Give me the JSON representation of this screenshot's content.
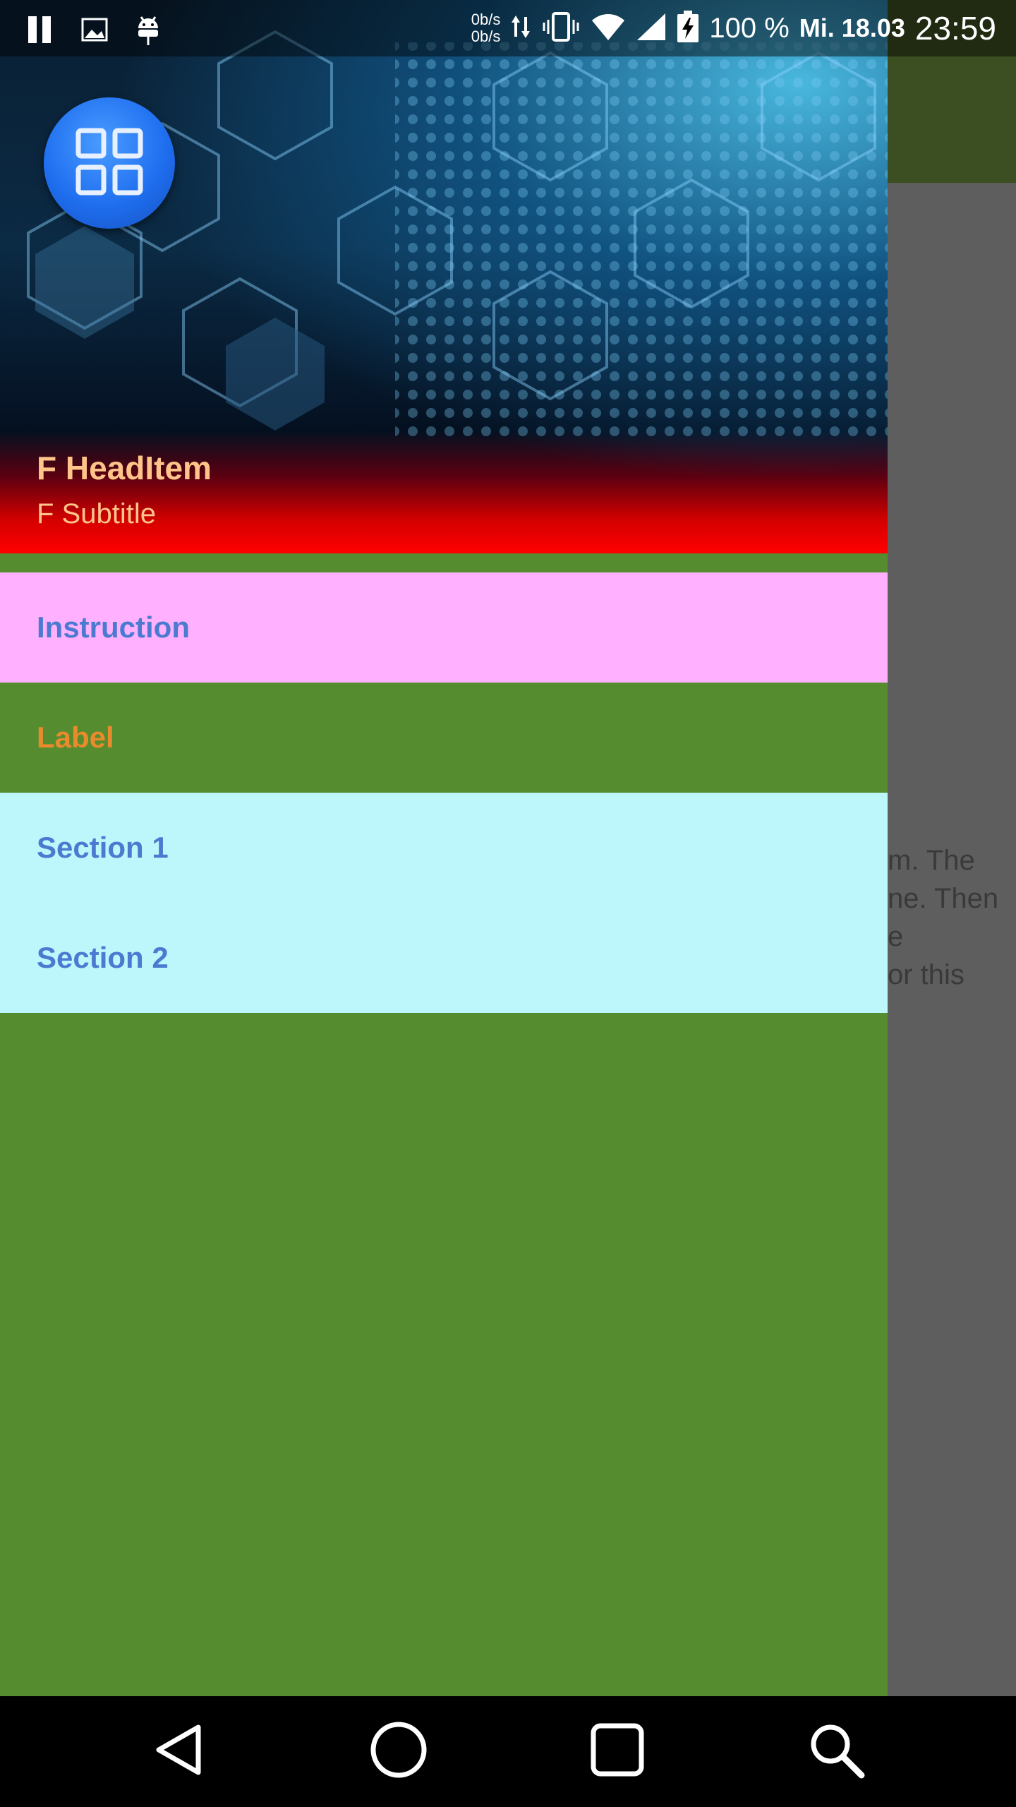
{
  "status_bar": {
    "left_icons": [
      "pause-icon",
      "image-icon",
      "android-icon"
    ],
    "net_speed_up": "0b/s",
    "net_speed_down": "0b/s",
    "battery": "100 %",
    "date": "Mi. 18.03",
    "time": "23:59"
  },
  "drawer": {
    "header": {
      "title": "F HeadItem",
      "subtitle": "F Subtitle",
      "avatar_icon": "grid-icon"
    },
    "items": [
      {
        "label": "Instruction"
      },
      {
        "label": "Label"
      },
      {
        "label": "Section 1"
      },
      {
        "label": "Section 2"
      }
    ]
  },
  "background_app": {
    "text_lines": [
      "m. The",
      "ne. Then",
      "e",
      "or this"
    ]
  },
  "nav_bar": {
    "buttons": [
      "back",
      "home",
      "recents",
      "search"
    ]
  },
  "colors": {
    "drawer_bg": "#548c2f",
    "instruction_bg": "#ffb1ff",
    "section_bg": "#bdf7fb",
    "item_text_blue": "#4a7bd0",
    "label_text_orange": "#e98a2c",
    "header_text": "#ffc48a"
  }
}
